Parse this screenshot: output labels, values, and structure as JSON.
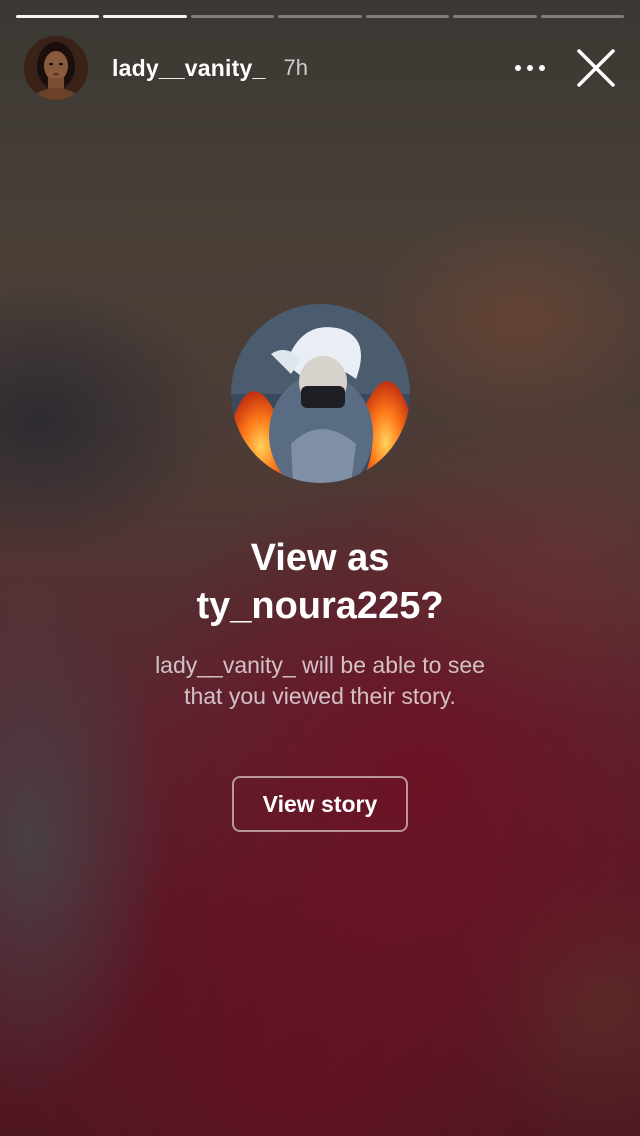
{
  "story": {
    "segment_count": 7,
    "segments_done": 2
  },
  "header": {
    "username": "lady__vanity_",
    "time": "7h",
    "more_icon": "more-dots-icon",
    "close_icon": "close-icon"
  },
  "prompt": {
    "title_line1": "View as",
    "title_line2": "ty_noura225?",
    "subtitle_line1": "lady__vanity_ will be able to see",
    "subtitle_line2": "that you viewed their story.",
    "button_label": "View story"
  }
}
